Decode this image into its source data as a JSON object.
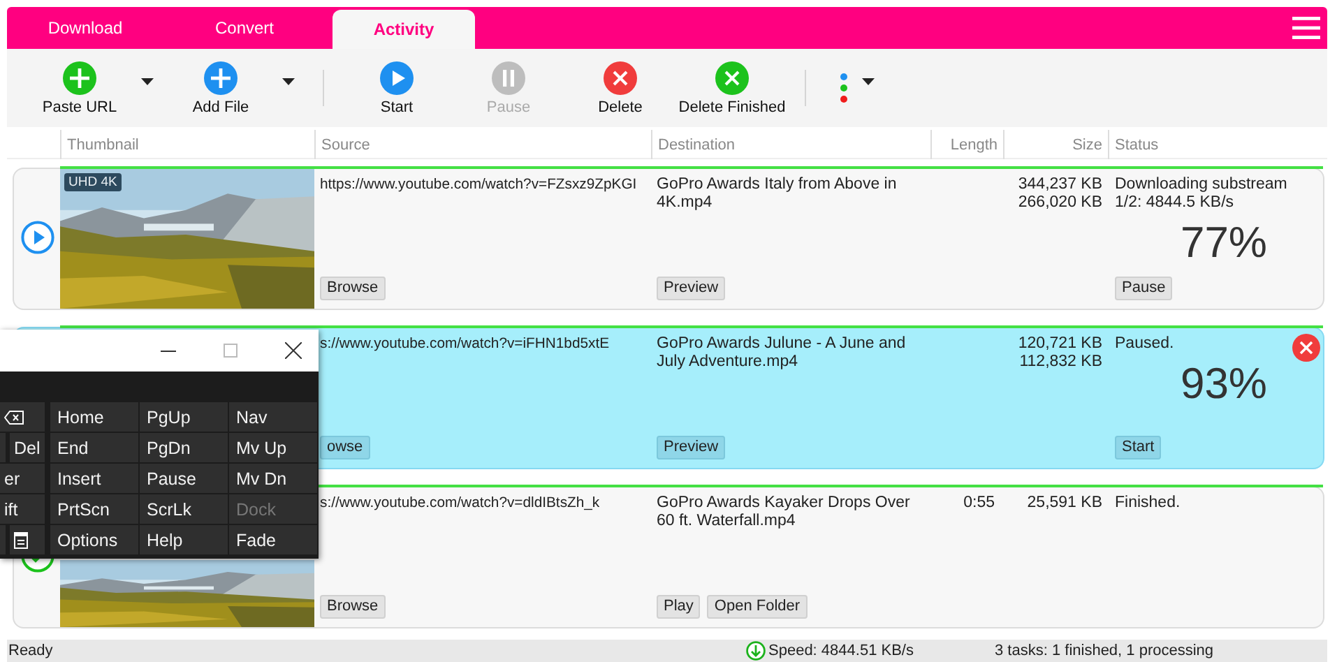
{
  "tabs": [
    {
      "label": "Download",
      "selected": false
    },
    {
      "label": "Convert",
      "selected": false
    },
    {
      "label": "Activity",
      "selected": true
    }
  ],
  "toolbar": [
    {
      "kind": "add",
      "color": "#1cc21c",
      "label": "Paste URL",
      "disabled": false,
      "dropdown": true
    },
    {
      "kind": "add",
      "color": "#1e90f0",
      "label": "Add File",
      "disabled": false,
      "dropdown": true
    },
    {
      "kind": "separator"
    },
    {
      "kind": "start",
      "color": "#1e90f0",
      "label": "Start",
      "disabled": false,
      "dropdown": false
    },
    {
      "kind": "pause",
      "color": "#bdbdbd",
      "label": "Pause",
      "disabled": true,
      "dropdown": false
    },
    {
      "kind": "delete",
      "color": "#f03c3c",
      "label": "Delete",
      "disabled": false,
      "dropdown": false
    },
    {
      "kind": "delete",
      "color": "#1cc21c",
      "label": "Delete Finished",
      "disabled": false,
      "dropdown": false
    },
    {
      "kind": "separator"
    },
    {
      "kind": "dots",
      "dropdown": true
    }
  ],
  "table": {
    "columns": [
      "Thumbnail",
      "Source",
      "Destination",
      "Length",
      "Size",
      "Status"
    ],
    "rows": [
      {
        "selected": false,
        "kind": "downloading",
        "thumbnail": {
          "kind": "picture",
          "badge": "UHD 4K"
        },
        "source": "https://www.youtube.com/watch?v=FZsxz9ZpKGI",
        "source_buttons": [
          "Browse"
        ],
        "destination": "GoPro Awards  Italy from Above in 4K.mp4",
        "destination_buttons": [
          "Preview"
        ],
        "sizes": [
          "344,237 KB",
          "266,020 KB"
        ],
        "status": "Downloading substream 1/2: 4844.5 KB/s",
        "percent": "77%",
        "status_buttons": [
          "Pause"
        ],
        "deletable": false
      },
      {
        "selected": true,
        "kind": "paused",
        "source": "s://www.youtube.com/watch?v=iFHN1bd5xtE",
        "source_buttons": [
          "owse"
        ],
        "destination": "GoPro Awards  Julune - A June and July Adventure.mp4",
        "destination_buttons": [
          "Preview"
        ],
        "sizes": [
          "120,721 KB",
          "112,832 KB"
        ],
        "status": "Paused.",
        "percent": "93%",
        "status_buttons": [
          "Start"
        ],
        "deletable": true
      },
      {
        "selected": false,
        "kind": "finished",
        "thumbnail": {
          "kind": "picture"
        },
        "source": "s://www.youtube.com/watch?v=dldIBtsZh_k",
        "source_buttons": [
          "Browse"
        ],
        "destination": "GoPro Awards  Kayaker Drops Over 60 ft. Waterfall.mp4",
        "destination_buttons": [
          "Play",
          "Open Folder"
        ],
        "length": "0:55",
        "sizes": [
          "25,591 KB"
        ],
        "status": "Finished.",
        "status_buttons": [],
        "deletable": false
      }
    ]
  },
  "status_bar": {
    "state": "Ready",
    "speed": "Speed: 4844.51 KB/s",
    "tasks": "3 tasks: 1 finished, 1 processing"
  },
  "keyboard": {
    "left_keys": [
      [
        {
          "kind": "backspace"
        }
      ],
      [
        {
          "kind": "stub"
        },
        {
          "kind": "text",
          "label": "Del"
        }
      ],
      [
        {
          "kind": "text",
          "label": "er"
        }
      ],
      [
        {
          "kind": "text",
          "label": "ift"
        }
      ],
      [
        {
          "kind": "stub"
        },
        {
          "kind": "menu"
        }
      ]
    ],
    "keys": [
      [
        {
          "label": "Home",
          "disabled": false
        },
        {
          "label": "PgUp",
          "disabled": false
        },
        {
          "label": "Nav",
          "disabled": false
        }
      ],
      [
        {
          "label": "End",
          "disabled": false
        },
        {
          "label": "PgDn",
          "disabled": false
        },
        {
          "label": "Mv Up",
          "disabled": false
        }
      ],
      [
        {
          "label": "Insert",
          "disabled": false
        },
        {
          "label": "Pause",
          "disabled": false
        },
        {
          "label": "Mv Dn",
          "disabled": false
        }
      ],
      [
        {
          "label": "PrtScn",
          "disabled": false
        },
        {
          "label": "ScrLk",
          "disabled": false
        },
        {
          "label": "Dock",
          "disabled": true
        }
      ],
      [
        {
          "label": "Options",
          "disabled": false
        },
        {
          "label": "Help",
          "disabled": false
        },
        {
          "label": "Fade",
          "disabled": false
        }
      ]
    ]
  }
}
